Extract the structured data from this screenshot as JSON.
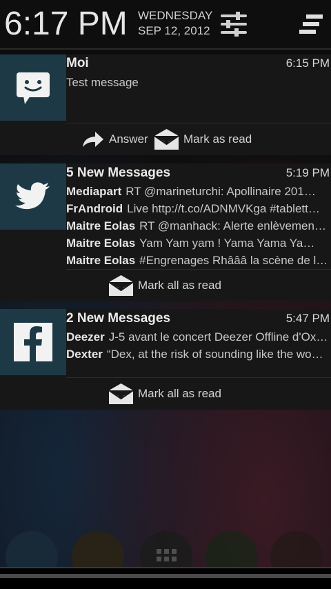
{
  "status_header": {
    "time": "6:17 PM",
    "day": "WEDNESDAY",
    "date": "SEP 12, 2012",
    "settings_icon": "sliders-icon",
    "clear_icon": "clear-all-icon"
  },
  "notifications": [
    {
      "app_icon": "messaging-icon",
      "title": "Moi",
      "time": "6:15 PM",
      "text": "Test message",
      "actions": [
        {
          "icon": "reply-arrow-icon",
          "label": "Answer"
        },
        {
          "icon": "envelope-open-icon",
          "label": "Mark as read"
        }
      ]
    },
    {
      "app_icon": "twitter-bird-icon",
      "title": "5 New Messages",
      "time": "5:19 PM",
      "lines": [
        {
          "sender": "Mediapart",
          "text": "RT @marineturchi: Apollinaire 201…"
        },
        {
          "sender": "FrAndroid",
          "text": "Live http://t.co/ADNMVKga #tablett…"
        },
        {
          "sender": "Maitre Eolas",
          "text": "RT @manhack: Alerte enlèvemen…"
        },
        {
          "sender": "Maitre Eolas",
          "text": "Yam Yam yam ! Yama Yama Ya…"
        },
        {
          "sender": "Maitre Eolas",
          "text": "#Engrenages Rhâââ la scène de l'…"
        }
      ],
      "actions": [
        {
          "icon": "envelope-open-icon",
          "label": "Mark all as read"
        }
      ]
    },
    {
      "app_icon": "facebook-icon",
      "title": "2 New Messages",
      "time": "5:47 PM",
      "lines": [
        {
          "sender": "Deezer",
          "text": "J-5 avant le concert Deezer Offline d'Ox…"
        },
        {
          "sender": "Dexter",
          "text": "“Dex, at the risk of sounding like the wo…"
        }
      ],
      "actions": [
        {
          "icon": "envelope-open-icon",
          "label": "Mark all as read"
        }
      ]
    }
  ],
  "colors": {
    "icon_background": "#1e3946",
    "card_background": "#171717"
  }
}
